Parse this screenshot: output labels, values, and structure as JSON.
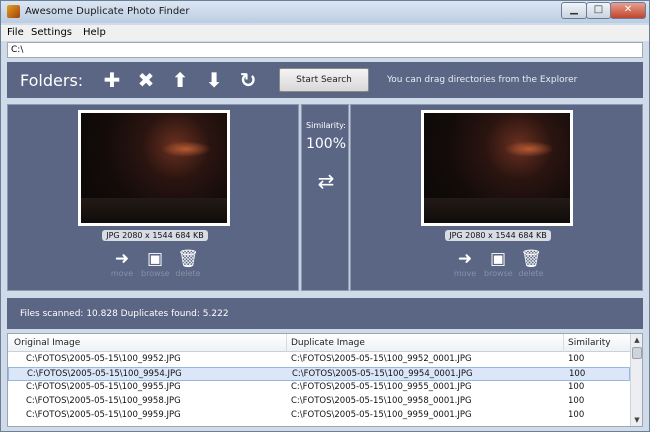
{
  "window": {
    "title": "Awesome Duplicate Photo Finder"
  },
  "menu": {
    "file": "File",
    "settings": "Settings",
    "help": "Help"
  },
  "path": {
    "value": "C:\\"
  },
  "toolbar": {
    "folders_label": "Folders:",
    "start_label": "Start Search",
    "hint": "You can drag directories from the Explorer"
  },
  "left": {
    "info": "JPG  2080 x 1544  684 KB",
    "move": "move",
    "browse": "browse",
    "delete": "delete"
  },
  "right": {
    "info": "JPG  2080 x 1544  684 KB",
    "move": "move",
    "browse": "browse",
    "delete": "delete"
  },
  "similarity": {
    "label": "Similarity:",
    "value": "100%"
  },
  "status": {
    "text": "Files scanned: 10.828  Duplicates found: 5.222"
  },
  "table": {
    "headers": [
      "Original Image",
      "Duplicate Image",
      "Similarity"
    ],
    "rows": [
      [
        "C:\\FOTOS\\2005-05-15\\100_9952.JPG",
        "C:\\FOTOS\\2005-05-15\\100_9952_0001.JPG",
        "100"
      ],
      [
        "C:\\FOTOS\\2005-05-15\\100_9954.JPG",
        "C:\\FOTOS\\2005-05-15\\100_9954_0001.JPG",
        "100"
      ],
      [
        "C:\\FOTOS\\2005-05-15\\100_9955.JPG",
        "C:\\FOTOS\\2005-05-15\\100_9955_0001.JPG",
        "100"
      ],
      [
        "C:\\FOTOS\\2005-05-15\\100_9958.JPG",
        "C:\\FOTOS\\2005-05-15\\100_9958_0001.JPG",
        "100"
      ],
      [
        "C:\\FOTOS\\2005-05-15\\100_9959.JPG",
        "C:\\FOTOS\\2005-05-15\\100_9959_0001.JPG",
        "100"
      ]
    ]
  },
  "colors": {
    "panel": "#5b6685",
    "selected_row": "#dbe7f8"
  }
}
